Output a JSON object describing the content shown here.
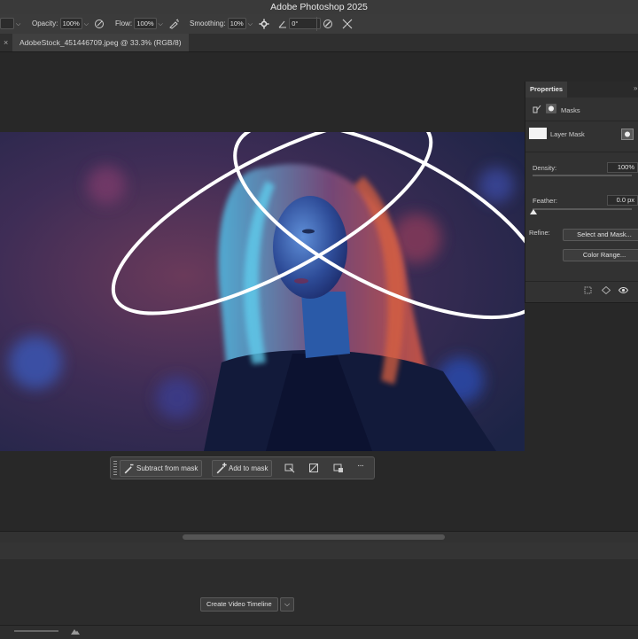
{
  "app": {
    "title": "Adobe Photoshop 2025"
  },
  "options_bar": {
    "opacity_label": "Opacity:",
    "opacity_value": "100%",
    "flow_label": "Flow:",
    "flow_value": "100%",
    "smoothing_label": "Smoothing:",
    "smoothing_value": "10%",
    "angle_value": "0°"
  },
  "document_tab": {
    "title": "AdobeStock_451446709.jpeg @ 33.3% (RGB/8)"
  },
  "properties": {
    "tab_label": "Properties",
    "section_label": "Masks",
    "layer_mask_label": "Layer Mask",
    "density_label": "Density:",
    "density_value": "100%",
    "density_level": 1.0,
    "feather_label": "Feather:",
    "feather_value": "0.0 px",
    "refine_label": "Refine:",
    "select_and_mask_label": "Select and Mask...",
    "color_range_label": "Color Range..."
  },
  "task_bar": {
    "subtract_label": "Subtract from mask",
    "add_label": "Add to mask",
    "more_label": "···"
  },
  "timeline": {
    "create_button_label": "Create Video Timeline"
  },
  "colors": {
    "accent_light": "#ffffff",
    "panel_bg": "#323232",
    "app_bg": "#282828"
  }
}
